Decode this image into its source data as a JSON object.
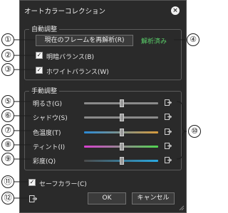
{
  "dialog": {
    "title": "オートカラーコレクション",
    "close_icon": "close-icon"
  },
  "auto_group": {
    "title": "自動調整",
    "reanalyze_button": "現在のフレームを再解析(R)",
    "status": "解析済み",
    "status_color": "#5bd36b",
    "options": [
      {
        "label": "明暗バランス(B)",
        "checked": true
      },
      {
        "label": "ホワイトバランス(W)",
        "checked": true
      }
    ]
  },
  "manual_group": {
    "title": "手動調整",
    "sliders": [
      {
        "label": "明るさ(G)",
        "value": 0.5,
        "reset_icon": "reset-icon"
      },
      {
        "label": "シャドウ(S)",
        "value": 0.5,
        "reset_icon": "reset-icon"
      },
      {
        "label": "色温度(T)",
        "value": 0.5,
        "reset_icon": "reset-icon",
        "gradient": [
          "#2a8ad6",
          "#d69a3c"
        ]
      },
      {
        "label": "ティント(I)",
        "value": 0.5,
        "reset_icon": "reset-icon",
        "gradient": [
          "#d83fd0",
          "#4fd64f"
        ]
      },
      {
        "label": "彩度(Q)",
        "value": 0.5,
        "reset_icon": "reset-icon",
        "gradient": [
          "#4a4a4a",
          "#2aa8e0"
        ]
      }
    ]
  },
  "safe_color": {
    "label": "セーフカラー(C)",
    "checked": true
  },
  "footer": {
    "reset_all_icon": "reset-icon",
    "ok": "OK",
    "cancel": "キャンセル"
  },
  "callouts": [
    "①",
    "②",
    "③",
    "④",
    "⑤",
    "⑥",
    "⑦",
    "⑧",
    "⑨",
    "⑩",
    "⑪",
    "⑫"
  ]
}
